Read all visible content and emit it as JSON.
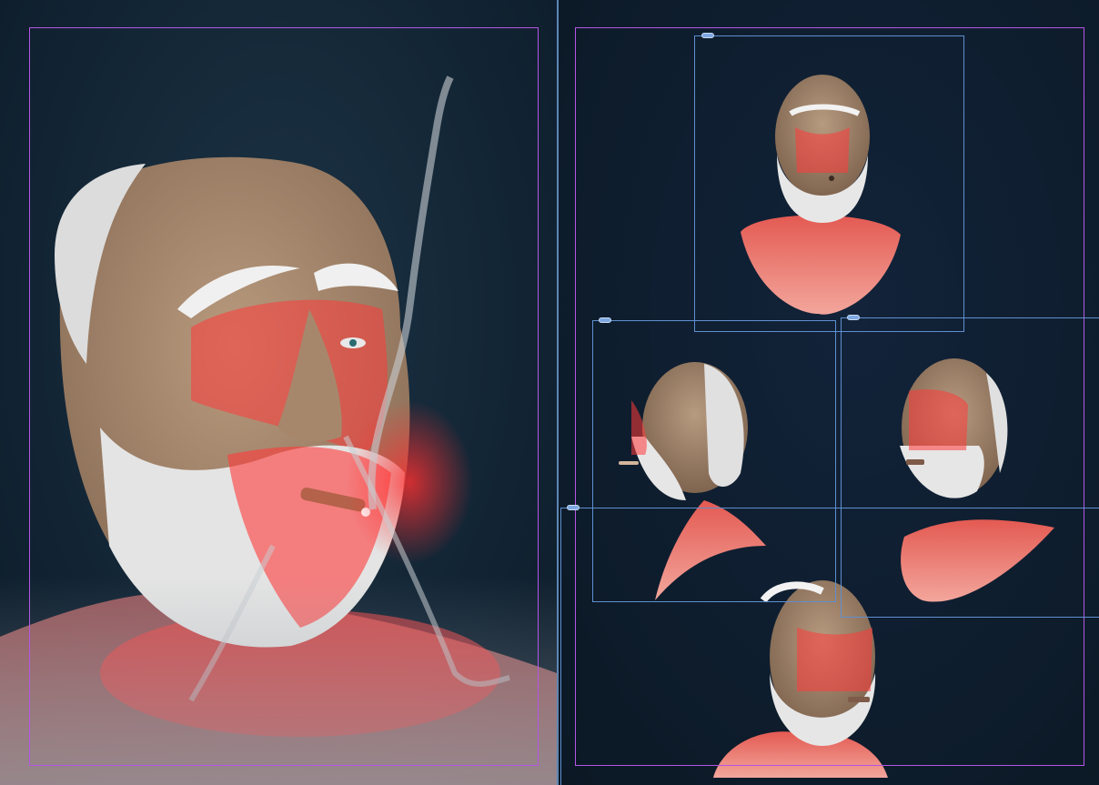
{
  "viewport": {
    "left_view": "perspective",
    "right_view": "multi-angle",
    "accent_color": "#b455e6",
    "frame_color": "#5f8fd0",
    "marker_color": "#f0c020"
  },
  "icons": {
    "top_marker": "triangle-marker-icon",
    "frame_handle": "frame-handle-icon"
  }
}
